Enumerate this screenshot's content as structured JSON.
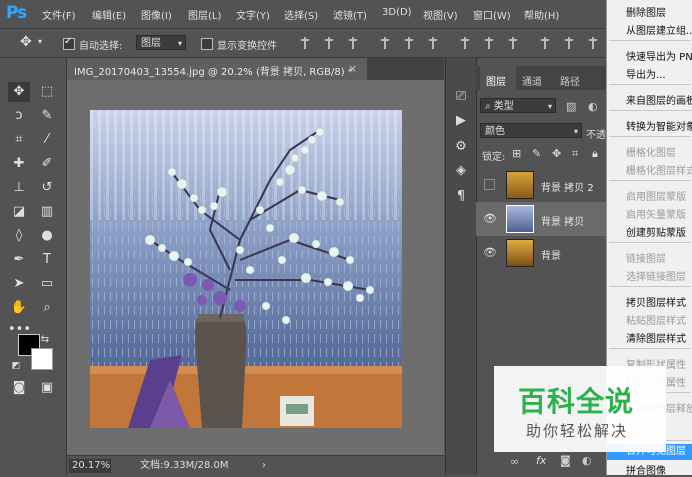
{
  "app": {
    "logo": "Ps"
  },
  "menubar": {
    "items": [
      "文件(F)",
      "编辑(E)",
      "图像(I)",
      "图层(L)",
      "文字(Y)",
      "选择(S)",
      "滤镜(T)",
      "3D(D)",
      "视图(V)",
      "窗口(W)",
      "帮助(H)"
    ]
  },
  "options": {
    "auto_select_label": "自动选择:",
    "auto_select_target": "图层",
    "show_transform_label": "显示变换控件"
  },
  "document": {
    "tab_title": "IMG_20170403_13554.jpg @ 20.2% (背景 拷贝, RGB/8) *",
    "close_glyph": "×"
  },
  "status": {
    "zoom": "20.17%",
    "doc_size": "文档:9.33M/28.0M",
    "arrow": "›"
  },
  "layers_panel": {
    "tabs": [
      "图层",
      "通道",
      "路径"
    ],
    "filter_label": "类型",
    "blend_mode": "颜色",
    "opacity_label": "不透",
    "lock_label": "锁定:",
    "layers": [
      {
        "name": "背景 拷贝 2",
        "visible": false,
        "selected": false
      },
      {
        "name": "背景 拷贝",
        "visible": true,
        "selected": true
      },
      {
        "name": "背景",
        "visible": true,
        "selected": false
      }
    ],
    "fx_label": "fx"
  },
  "context_menu": {
    "items": [
      {
        "label": "删除图层",
        "disabled": false,
        "highlight": false
      },
      {
        "label": "从图层建立组...",
        "disabled": false,
        "highlight": false
      },
      {
        "label": "快速导出为 PN",
        "disabled": false,
        "highlight": false
      },
      {
        "label": "导出为...",
        "disabled": false,
        "highlight": false
      },
      {
        "label": "来自图层的画板",
        "disabled": false,
        "highlight": false
      },
      {
        "label": "转换为智能对象",
        "disabled": false,
        "highlight": false
      },
      {
        "label": "栅格化图层",
        "disabled": true,
        "highlight": false
      },
      {
        "label": "栅格化图层样式",
        "disabled": true,
        "highlight": false
      },
      {
        "label": "启用图层蒙版",
        "disabled": true,
        "highlight": false
      },
      {
        "label": "启用矢量蒙版",
        "disabled": true,
        "highlight": false
      },
      {
        "label": "创建剪贴蒙版",
        "disabled": false,
        "highlight": false
      },
      {
        "label": "链接图层",
        "disabled": true,
        "highlight": false
      },
      {
        "label": "选择链接图层",
        "disabled": true,
        "highlight": false
      },
      {
        "label": "拷贝图层样式",
        "disabled": false,
        "highlight": false
      },
      {
        "label": "粘贴图层样式",
        "disabled": true,
        "highlight": false
      },
      {
        "label": "清除图层样式",
        "disabled": false,
        "highlight": false
      },
      {
        "label": "复制形状属性",
        "disabled": true,
        "highlight": false
      },
      {
        "label": "粘贴形状属性",
        "disabled": true,
        "highlight": false
      },
      {
        "label": "从隔离图层释放",
        "disabled": true,
        "highlight": false
      },
      {
        "label": "合并可见图层",
        "disabled": false,
        "highlight": true
      },
      {
        "label": "拼合图像",
        "disabled": false,
        "highlight": false
      }
    ]
  },
  "watermark": {
    "title": "百科全说",
    "subtitle": "助你轻松解决"
  },
  "colors": {
    "accent": "#31a8ff",
    "highlight": "#3399ff",
    "watermark_green": "#2bb24c"
  }
}
